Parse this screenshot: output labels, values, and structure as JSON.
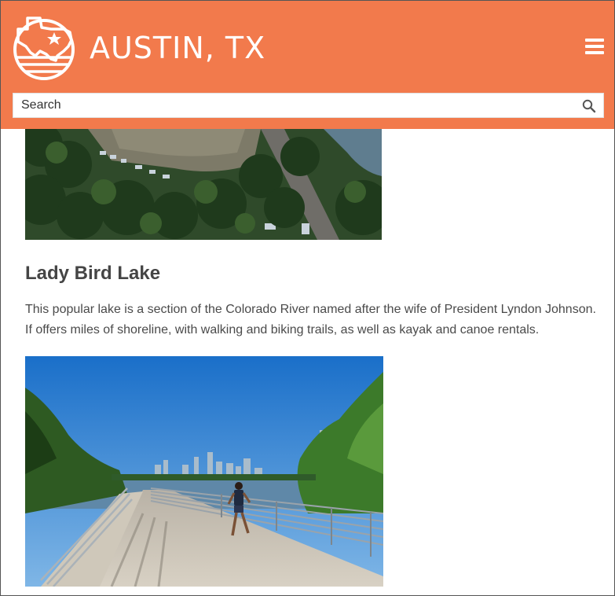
{
  "header": {
    "site_title": "AUSTIN, TX",
    "logo_icon": "texas-logo-icon",
    "menu_icon": "hamburger-menu-icon",
    "bg_color": "#f27a4c"
  },
  "search": {
    "placeholder": "Search",
    "icon": "search-icon"
  },
  "main": {
    "top_photo_alt": "Aerial view of festival crowd in park",
    "section": {
      "title": "Lady Bird Lake",
      "description": "This popular lake is a section of the Colorado River named after the wife of President Lyndon Johnson. If offers miles of shoreline, with walking and biking trails, as well as kayak and canoe rentals."
    },
    "bottom_photo_alt": "Runner on boardwalk trail with Austin skyline"
  }
}
